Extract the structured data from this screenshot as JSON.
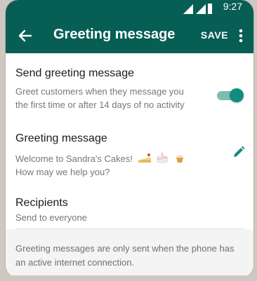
{
  "status_bar": {
    "time": "9:27"
  },
  "app_bar": {
    "title": "Greeting message",
    "save_label": "SAVE",
    "icons": {
      "back": "back-arrow-icon",
      "more": "more-vert-icon"
    }
  },
  "send_greeting": {
    "title": "Send greeting message",
    "description": "Greet customers when they message you the first time or after 14 days of no activity",
    "toggle_on": true
  },
  "greeting_message": {
    "title": "Greeting message",
    "text_line1": "Welcome to Sandra's Cakes!",
    "text_line2": "How may we help you?",
    "emojis": [
      "cake-slice",
      "cake",
      "cupcake"
    ],
    "edit_icon": "pencil-icon"
  },
  "recipients": {
    "title": "Recipients",
    "value": "Send to everyone"
  },
  "footer": {
    "note": "Greeting messages are only sent when the phone has an active internet connection."
  },
  "colors": {
    "brand": "#075e54",
    "accent": "#128c7e",
    "toggle_track": "#7dbcb3"
  }
}
